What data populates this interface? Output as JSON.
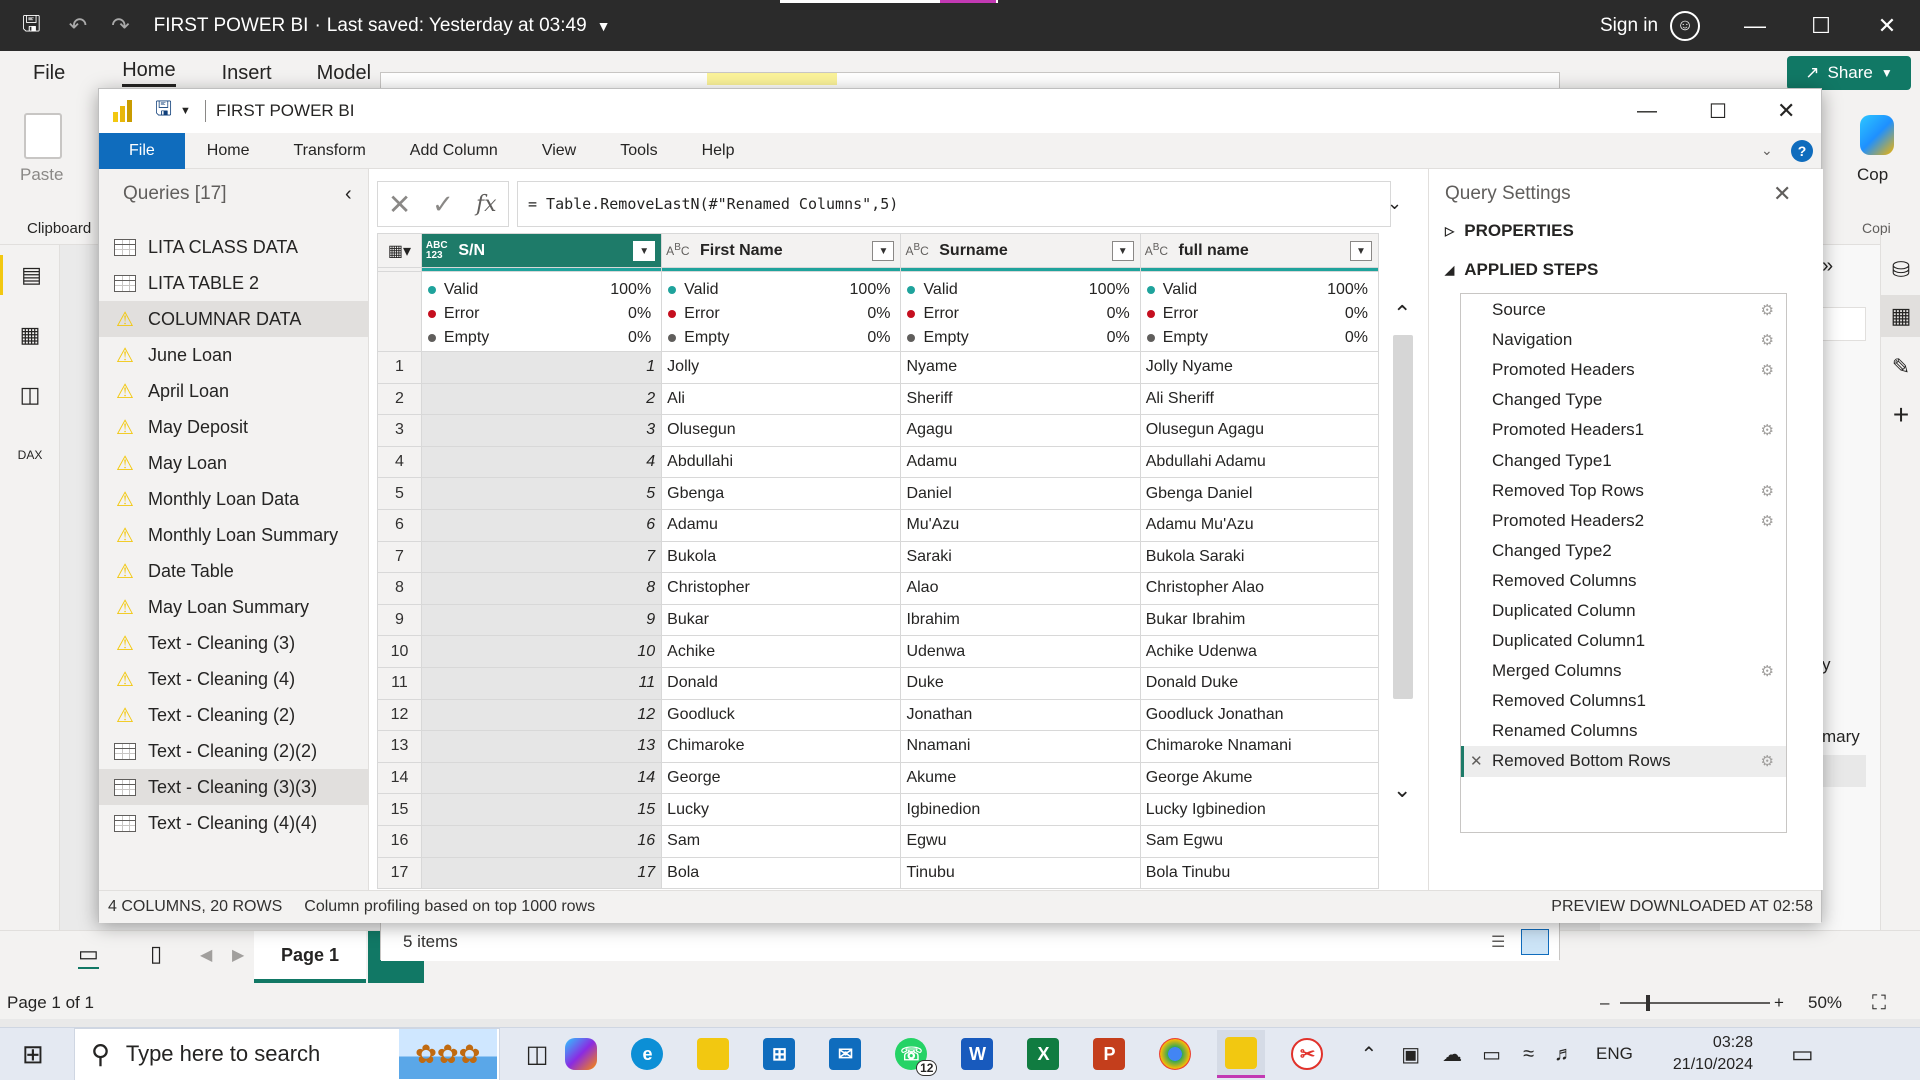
{
  "pbi": {
    "title": "FIRST POWER BI",
    "last_saved": "Last saved: Yesterday at 03:49",
    "sign_in": "Sign in",
    "ribbon_tabs": [
      "File",
      "Home",
      "Insert",
      "Model"
    ],
    "share": "Share",
    "paste": "Paste",
    "clipboard": "Clipboard",
    "copilot": "Cop",
    "copilot_short": "Copi",
    "page_tab": "Page 1",
    "items_count": "5 items",
    "page_status": "Page 1 of 1",
    "zoom": "50%",
    "right_text_1": "y",
    "right_text_2": "mary"
  },
  "pq": {
    "title": "FIRST POWER BI",
    "tabs": [
      "File",
      "Home",
      "Transform",
      "Add Column",
      "View",
      "Tools",
      "Help"
    ],
    "formula": "= Table.RemoveLastN(#\"Renamed Columns\",5)",
    "queries_title": "Queries [17]",
    "queries": [
      {
        "name": "LITA CLASS DATA",
        "icon": "table-icon"
      },
      {
        "name": "LITA TABLE 2",
        "icon": "table-icon"
      },
      {
        "name": "COLUMNAR DATA",
        "icon": "warning-icon"
      },
      {
        "name": "June Loan",
        "icon": "warning-icon"
      },
      {
        "name": "April Loan",
        "icon": "warning-icon"
      },
      {
        "name": "May Deposit",
        "icon": "warning-icon"
      },
      {
        "name": "May Loan",
        "icon": "warning-icon"
      },
      {
        "name": "Monthly Loan Data",
        "icon": "warning-icon"
      },
      {
        "name": "Monthly Loan Summary",
        "icon": "warning-icon"
      },
      {
        "name": "Date Table",
        "icon": "warning-icon"
      },
      {
        "name": "May Loan Summary",
        "icon": "warning-icon"
      },
      {
        "name": "Text - Cleaning (3)",
        "icon": "warning-icon"
      },
      {
        "name": "Text - Cleaning (4)",
        "icon": "warning-icon"
      },
      {
        "name": "Text - Cleaning (2)",
        "icon": "warning-icon"
      },
      {
        "name": "Text - Cleaning (2)(2)",
        "icon": "table-icon"
      },
      {
        "name": "Text - Cleaning (3)(3)",
        "icon": "table-icon"
      },
      {
        "name": "Text - Cleaning (4)(4)",
        "icon": "table-icon"
      }
    ],
    "columns": [
      {
        "name": "S/N",
        "type": "ABC 123"
      },
      {
        "name": "First Name",
        "type": "ABC"
      },
      {
        "name": "Surname",
        "type": "ABC"
      },
      {
        "name": "full name",
        "type": "ABC"
      }
    ],
    "profile": {
      "labels": [
        "Valid",
        "Error",
        "Empty"
      ],
      "values": [
        "100%",
        "0%",
        "0%"
      ],
      "colors": [
        "#1fa39c",
        "#c50f1f",
        "#605e5c"
      ]
    },
    "rows": [
      [
        "1",
        "Jolly",
        "Nyame",
        "Jolly Nyame"
      ],
      [
        "2",
        "Ali",
        "Sheriff",
        "Ali Sheriff"
      ],
      [
        "3",
        "Olusegun",
        "Agagu",
        "Olusegun Agagu"
      ],
      [
        "4",
        "Abdullahi",
        "Adamu",
        "Abdullahi Adamu"
      ],
      [
        "5",
        "Gbenga",
        "Daniel",
        "Gbenga Daniel"
      ],
      [
        "6",
        "Adamu",
        "Mu'Azu",
        "Adamu Mu'Azu"
      ],
      [
        "7",
        "Bukola",
        "Saraki",
        "Bukola Saraki"
      ],
      [
        "8",
        "Christopher",
        "Alao",
        "Christopher Alao"
      ],
      [
        "9",
        "Bukar",
        "Ibrahim",
        "Bukar Ibrahim"
      ],
      [
        "10",
        "Achike",
        "Udenwa",
        "Achike Udenwa"
      ],
      [
        "11",
        "Donald",
        "Duke",
        "Donald Duke"
      ],
      [
        "12",
        "Goodluck",
        "Jonathan",
        "Goodluck Jonathan"
      ],
      [
        "13",
        "Chimaroke",
        "Nnamani",
        "Chimaroke Nnamani"
      ],
      [
        "14",
        "George",
        "Akume",
        "George Akume"
      ],
      [
        "15",
        "Lucky",
        "Igbinedion",
        "Lucky Igbinedion"
      ],
      [
        "16",
        "Sam",
        "Egwu",
        "Sam Egwu"
      ],
      [
        "17",
        "Bola",
        "Tinubu",
        "Bola Tinubu"
      ]
    ],
    "settings_title": "Query Settings",
    "properties": "PROPERTIES",
    "applied_steps": "APPLIED STEPS",
    "steps": [
      {
        "name": "Source",
        "gear": true
      },
      {
        "name": "Navigation",
        "gear": true
      },
      {
        "name": "Promoted Headers",
        "gear": true
      },
      {
        "name": "Changed Type",
        "gear": false
      },
      {
        "name": "Promoted Headers1",
        "gear": true
      },
      {
        "name": "Changed Type1",
        "gear": false
      },
      {
        "name": "Removed Top Rows",
        "gear": true
      },
      {
        "name": "Promoted Headers2",
        "gear": true
      },
      {
        "name": "Changed Type2",
        "gear": false
      },
      {
        "name": "Removed Columns",
        "gear": false
      },
      {
        "name": "Duplicated Column",
        "gear": false
      },
      {
        "name": "Duplicated Column1",
        "gear": false
      },
      {
        "name": "Merged Columns",
        "gear": true
      },
      {
        "name": "Removed Columns1",
        "gear": false
      },
      {
        "name": "Renamed Columns",
        "gear": false
      },
      {
        "name": "Removed Bottom Rows",
        "gear": true
      }
    ],
    "status_left": "4 COLUMNS, 20 ROWS",
    "status_profile": "Column profiling based on top 1000 rows",
    "status_right": "PREVIEW DOWNLOADED AT 02:58"
  },
  "taskbar": {
    "search_placeholder": "Type here to search",
    "language": "ENG",
    "time": "03:28",
    "date": "21/10/2024",
    "whatsapp_badge": "12"
  },
  "colors": {
    "accent": "#0f6cbd",
    "selected_column": "#1e7b69",
    "warning": "#f2c811"
  }
}
